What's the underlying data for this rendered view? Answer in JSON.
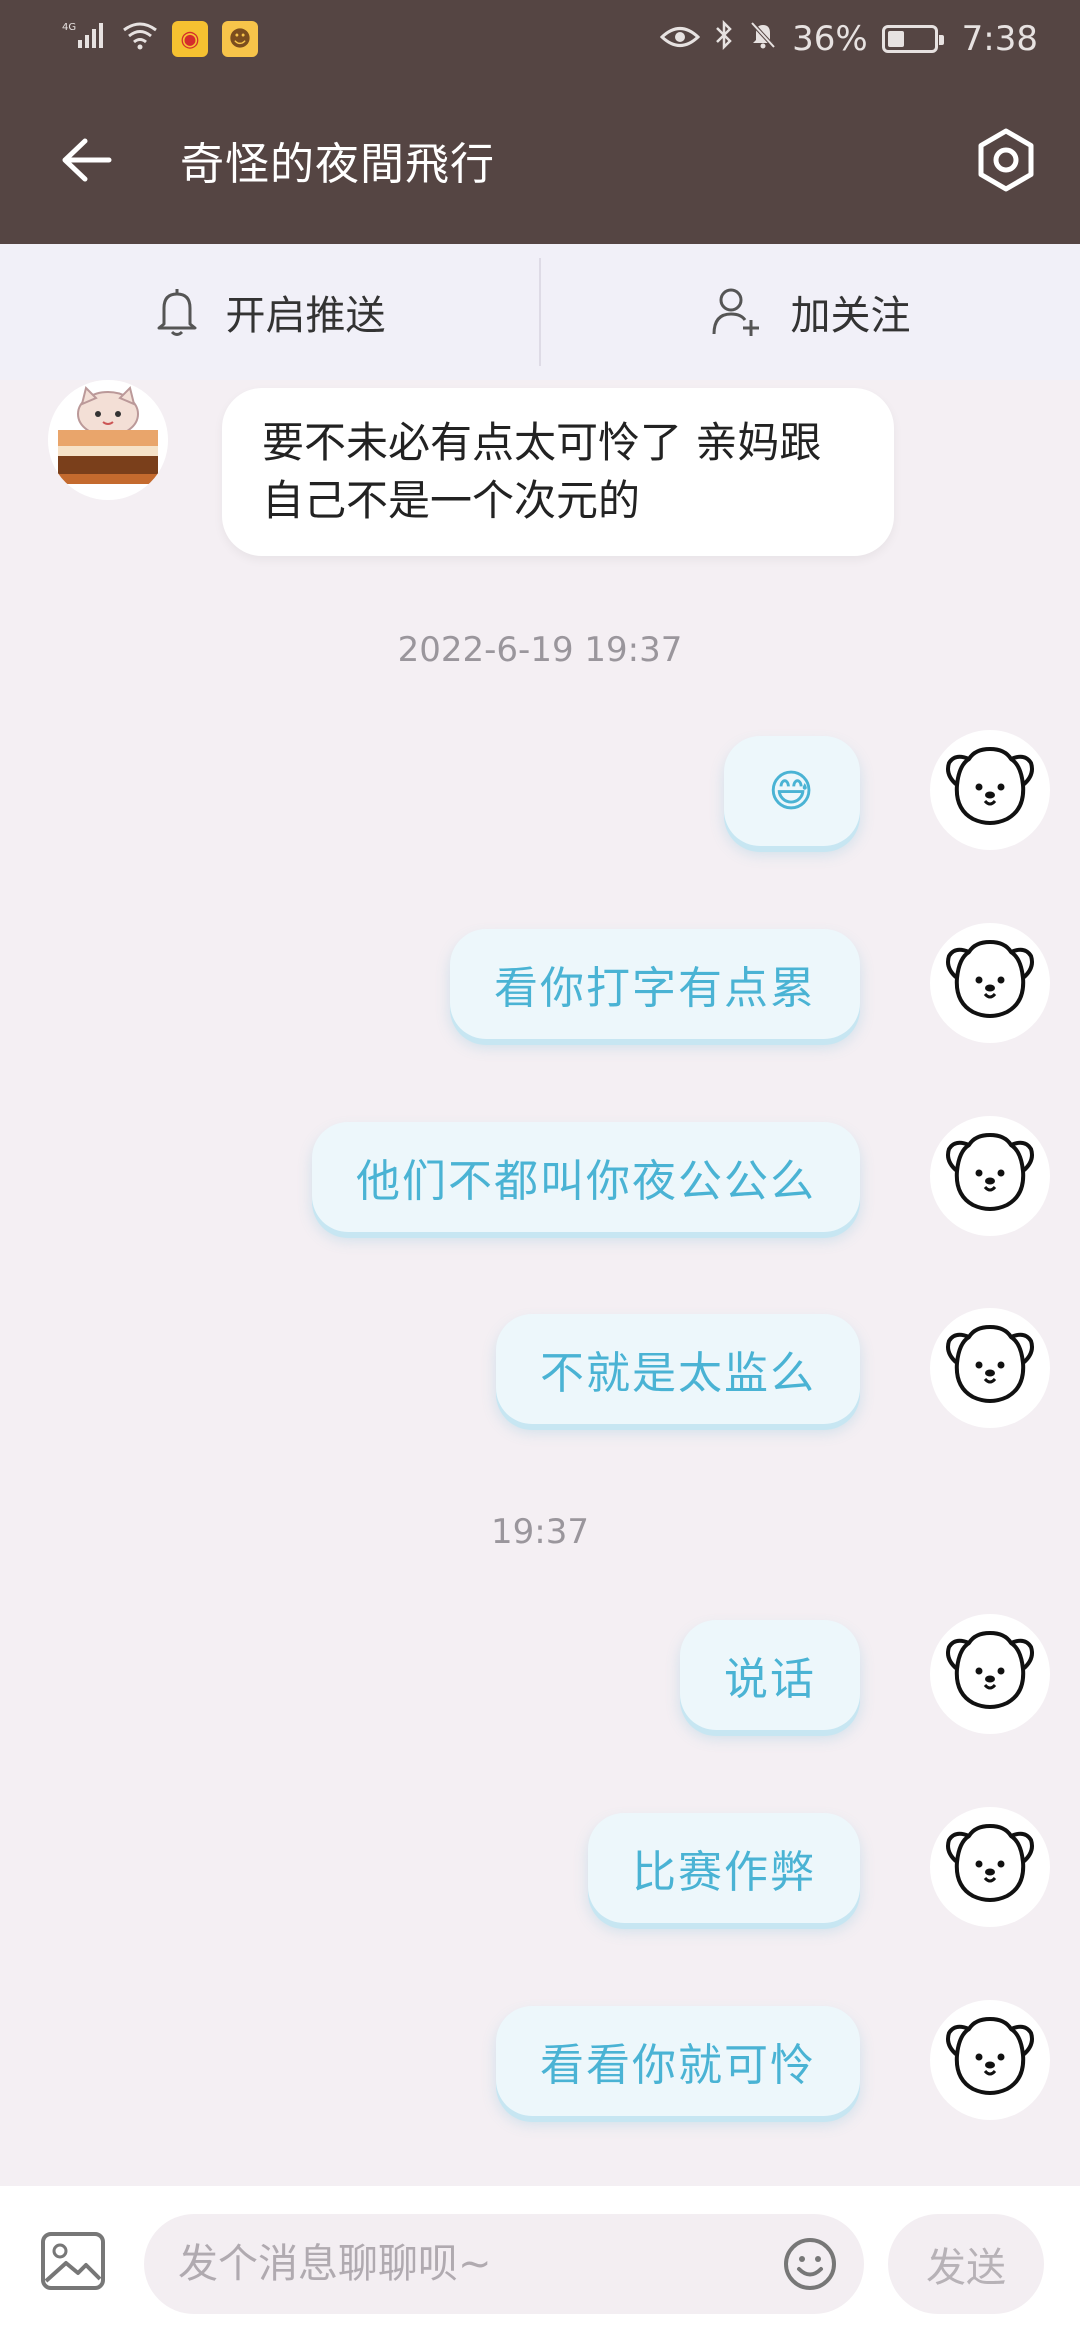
{
  "status_bar": {
    "network": "4G",
    "battery": "36%",
    "battery_level": 0.36,
    "time": "7:38"
  },
  "header": {
    "title": "奇怪的夜間飛行"
  },
  "actions": {
    "push_label": "开启推送",
    "follow_label": "加关注"
  },
  "messages": {
    "incoming": {
      "text": "要不未必有点太可怜了 亲妈跟自己不是一个次元的"
    },
    "timestamp_1": "2022-6-19 19:37",
    "outgoing_1": [
      "😅",
      "看你打字有点累",
      "他们不都叫你夜公公么",
      "不就是太监么"
    ],
    "timestamp_2": "19:37",
    "outgoing_2": [
      "说话",
      "比赛作弊",
      "看看你就可怜"
    ]
  },
  "input": {
    "placeholder": "发个消息聊聊呗~",
    "send_label": "发送"
  }
}
